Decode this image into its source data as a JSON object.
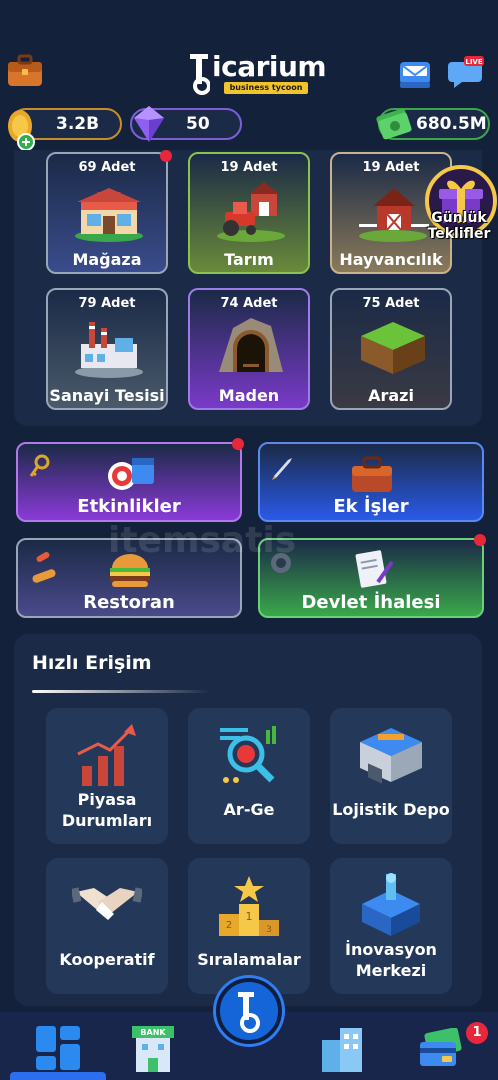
{
  "header": {
    "logo_word": "icarium",
    "logo_sub": "business tycoon"
  },
  "currency": {
    "gold": "3.2B",
    "gems": "50",
    "cash": "680.5M"
  },
  "businesses": [
    {
      "count": "69 Adet",
      "label": "Mağaza"
    },
    {
      "count": "19 Adet",
      "label": "Tarım"
    },
    {
      "count": "19 Adet",
      "label": "Hayvancılık"
    },
    {
      "count": "79 Adet",
      "label": "Sanayi Tesisi"
    },
    {
      "count": "74 Adet",
      "label": "Maden"
    },
    {
      "count": "75 Adet",
      "label": "Arazi"
    }
  ],
  "daily_offers": {
    "line1": "Günlük",
    "line2": "Teklifler"
  },
  "actions": [
    {
      "label": "Etkinlikler"
    },
    {
      "label": "Ek İşler"
    },
    {
      "label": "Restoran"
    },
    {
      "label": "Devlet İhalesi"
    }
  ],
  "quick_access": {
    "title": "Hızlı Erişim",
    "items": [
      {
        "line1": "Piyasa",
        "line2": "Durumları"
      },
      {
        "line1": "Ar-Ge",
        "line2": ""
      },
      {
        "line1": "Lojistik Depo",
        "line2": ""
      },
      {
        "line1": "Kooperatif",
        "line2": ""
      },
      {
        "line1": "Sıralamalar",
        "line2": ""
      },
      {
        "line1": "İnovasyon",
        "line2": "Merkezi"
      }
    ]
  },
  "nav": {
    "bank_label": "BANK",
    "badge_count": "1",
    "live_label": "LIVE"
  },
  "watermark": "itemsatis",
  "colors": {
    "background": "#14213a",
    "panel": "#1b2a47",
    "accent_blue": "#2b6ff0",
    "badge_red": "#e8283a"
  }
}
